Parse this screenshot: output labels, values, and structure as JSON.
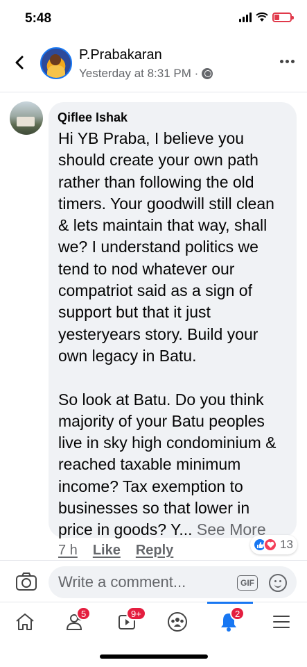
{
  "status_bar": {
    "time": "5:48"
  },
  "header": {
    "name": "P.Prabakaran",
    "subtitle": "Yesterday at 8:31 PM ·"
  },
  "comment": {
    "author": "Qiflee Ishak",
    "text": "Hi YB Praba, I believe you should create your own path rather than following the old timers. Your goodwill still clean & lets maintain that way, shall we? I understand politics we tend to nod whatever our compatriot said as a sign of support but that it just yesteryears story. Build your own legacy in Batu.\n\nSo look at Batu. Do you think majority of your Batu peoples live in sky high condominium & reached taxable minimum income? Tax exemption to businesses so that lower in price in goods? Y... ",
    "see_more": "See More",
    "time_ago": "7 h",
    "like_label": "Like",
    "reply_label": "Reply",
    "reaction_count": "13",
    "reactions": [
      "like",
      "love"
    ]
  },
  "composer": {
    "placeholder": "Write a comment...",
    "gif_label": "GIF"
  },
  "bottom_nav": {
    "friends_badge": "5",
    "watch_badge": "9+",
    "notifications_badge": "2"
  },
  "colors": {
    "accent": "#1877f2",
    "badge": "#e41e3f",
    "bubble": "#f0f2f5",
    "secondary_text": "#65676b"
  }
}
